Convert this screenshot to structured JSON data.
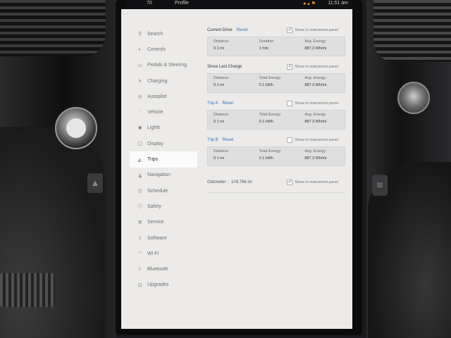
{
  "status_bar": {
    "temp": "70",
    "profile": "Profile",
    "time": "11:51 am"
  },
  "sidebar": {
    "items": [
      {
        "label": "Search",
        "icon": "search-icon",
        "glyph": "⚲"
      },
      {
        "label": "Controls",
        "icon": "toggle-icon",
        "glyph": "◐"
      },
      {
        "label": "Pedals & Steering",
        "icon": "car-icon",
        "glyph": "▭"
      },
      {
        "label": "Charging",
        "icon": "lightning-icon",
        "glyph": "ϟ"
      },
      {
        "label": "Autopilot",
        "icon": "steering-wheel-icon",
        "glyph": "◎"
      },
      {
        "label": "Vehicle",
        "icon": "sliders-icon",
        "glyph": "⫶"
      },
      {
        "label": "Lights",
        "icon": "lightbulb-icon",
        "glyph": "✺"
      },
      {
        "label": "Display",
        "icon": "display-icon",
        "glyph": "▢"
      },
      {
        "label": "Trips",
        "icon": "trips-icon",
        "glyph": "◭",
        "active": true
      },
      {
        "label": "Navigation",
        "icon": "navigation-icon",
        "glyph": "◮"
      },
      {
        "label": "Schedule",
        "icon": "clock-icon",
        "glyph": "◷"
      },
      {
        "label": "Safety",
        "icon": "safety-icon",
        "glyph": "ⓘ"
      },
      {
        "label": "Service",
        "icon": "wrench-icon",
        "glyph": "⚒"
      },
      {
        "label": "Software",
        "icon": "download-icon",
        "glyph": "⤓"
      },
      {
        "label": "Wi-Fi",
        "icon": "wifi-icon",
        "glyph": "◠"
      },
      {
        "label": "Bluetooth",
        "icon": "bluetooth-icon",
        "glyph": "ᛒ"
      },
      {
        "label": "Upgrades",
        "icon": "upgrades-icon",
        "glyph": "⊡"
      }
    ]
  },
  "sections": [
    {
      "title": "Current Drive",
      "reset": "Reset",
      "show_label": "Show in instrument panel",
      "checked": true,
      "stats": [
        {
          "label": "Distance",
          "value": "0.1 mi"
        },
        {
          "label": "Duration",
          "value": "1 min"
        },
        {
          "label": "Avg. Energy",
          "value": "887.3 Wh/mi"
        }
      ]
    },
    {
      "title": "Since Last Charge",
      "reset": "",
      "show_label": "Show in instrument panel",
      "checked": true,
      "stats": [
        {
          "label": "Distance",
          "value": "0.1 mi"
        },
        {
          "label": "Total Energy",
          "value": "0.1 kWh"
        },
        {
          "label": "Avg. Energy",
          "value": "887.3 Wh/mi"
        }
      ]
    },
    {
      "title": "Trip A",
      "reset": "Reset",
      "show_label": "Show in instrument panel",
      "checked": false,
      "stats": [
        {
          "label": "Distance",
          "value": "0.1 mi"
        },
        {
          "label": "Total Energy",
          "value": "0.1 kWh"
        },
        {
          "label": "Avg. Energy",
          "value": "887.3 Wh/mi"
        }
      ]
    },
    {
      "title": "Trip B",
      "reset": "Reset",
      "show_label": "Show in instrument panel",
      "checked": false,
      "stats": [
        {
          "label": "Distance",
          "value": "0.1 mi"
        },
        {
          "label": "Total Energy",
          "value": "0.1 kWh"
        },
        {
          "label": "Avg. Energy",
          "value": "887.3 Wh/mi"
        }
      ]
    }
  ],
  "odometer": {
    "label": "Odometer :",
    "value": "109,796 mi",
    "show_label": "Show in instrument panel",
    "checked": true
  },
  "colors": {
    "accent": "#2f6fbf",
    "screen_bg": "#ecebea",
    "stat_box": "#dfdfdf"
  }
}
